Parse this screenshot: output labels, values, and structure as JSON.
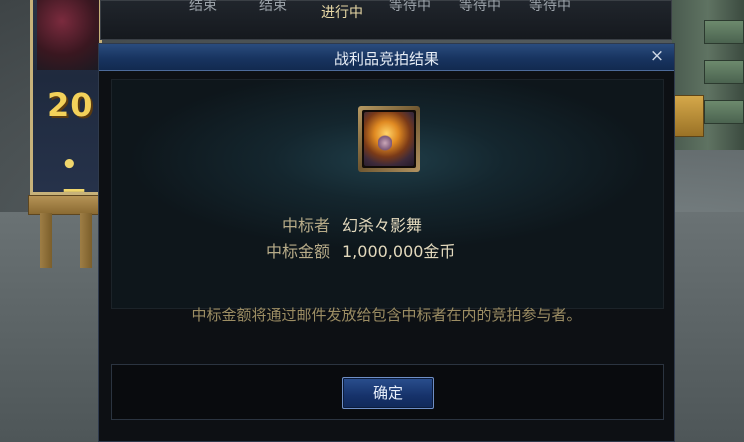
{
  "background": {
    "status_bar": [
      "结束",
      "结束",
      "进行中",
      "等待中",
      "等待中",
      "等待中"
    ],
    "poster": {
      "year_text": "20",
      "bullet_text": "• 三"
    }
  },
  "dialog": {
    "title": "战利品竞拍结果",
    "close_symbol": "×",
    "item_icon": "auction-item-orb-icon",
    "winner_label": "中标者",
    "winner_value": "幻杀々影舞",
    "amount_label": "中标金额",
    "amount_value": "1,000,000金币",
    "notice": "中标金额将通过邮件发放给包含中标者在内的竞拍参与者。",
    "confirm_label": "确定"
  },
  "colors": {
    "title_bar": "#183460",
    "label": "#b7ab88",
    "value": "#e3d9bd",
    "notice": "#9c8d63",
    "button": "#16326a"
  }
}
